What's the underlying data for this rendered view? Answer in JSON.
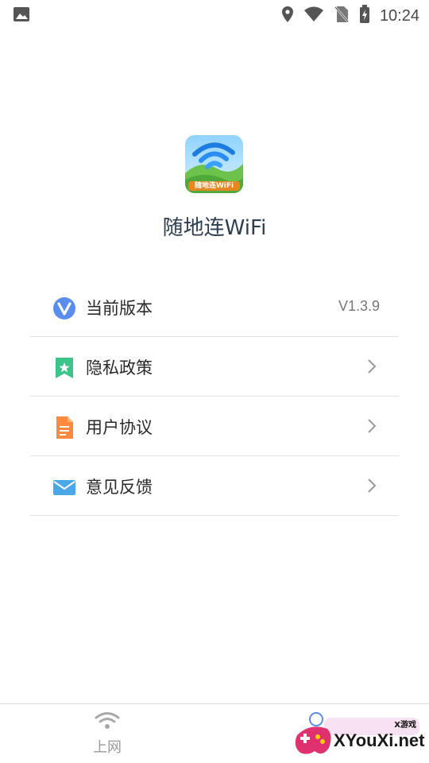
{
  "status_bar": {
    "time": "10:24",
    "icons": [
      "image-icon",
      "location-icon",
      "wifi-icon",
      "no-sim-icon",
      "battery-charging-icon"
    ]
  },
  "app": {
    "name": "随地连WiFi",
    "logo_text": "随地连WiFi"
  },
  "menu": {
    "items": [
      {
        "label": "当前版本",
        "value": "V1.3.9",
        "icon": "version-v-icon"
      },
      {
        "label": "隐私政策",
        "icon": "privacy-bookmark-icon"
      },
      {
        "label": "用户协议",
        "icon": "document-icon"
      },
      {
        "label": "意见反馈",
        "icon": "mail-icon"
      }
    ]
  },
  "bottom_nav": {
    "tab_net_label": "上网"
  },
  "watermark": {
    "site": "XYouXi.net",
    "small": "X游戏"
  },
  "colors": {
    "accent_blue": "#5b8def",
    "privacy_green": "#3cc48a",
    "doc_orange": "#ff8a3d",
    "mail_blue": "#4aa8e8"
  }
}
